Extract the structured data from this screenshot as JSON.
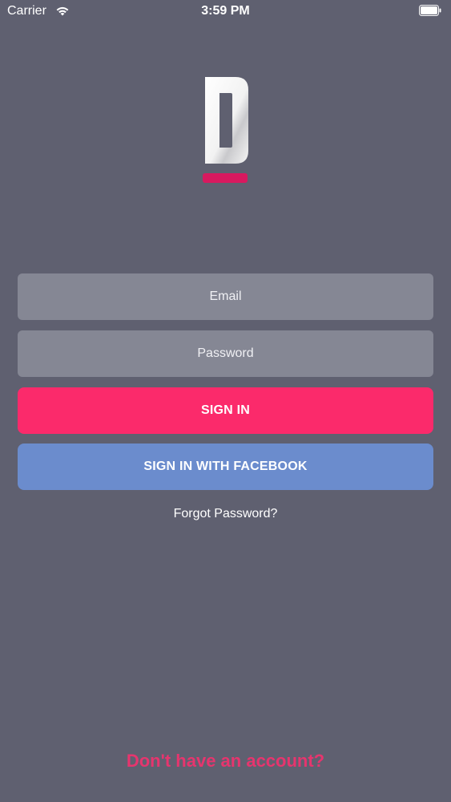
{
  "status_bar": {
    "carrier": "Carrier",
    "time": "3:59 PM"
  },
  "logo": {
    "accent_color": "#d8195f"
  },
  "form": {
    "email_placeholder": "Email",
    "password_placeholder": "Password",
    "sign_in_label": "SIGN IN",
    "facebook_label": "SIGN IN WITH FACEBOOK",
    "forgot_label": "Forgot Password?"
  },
  "footer": {
    "signup_label": "Don't have an account?"
  },
  "colors": {
    "background": "#5f6070",
    "field": "#858794",
    "sign_in": "#fb2a6b",
    "facebook": "#6b8ccd",
    "signup_text": "#e6356e"
  }
}
